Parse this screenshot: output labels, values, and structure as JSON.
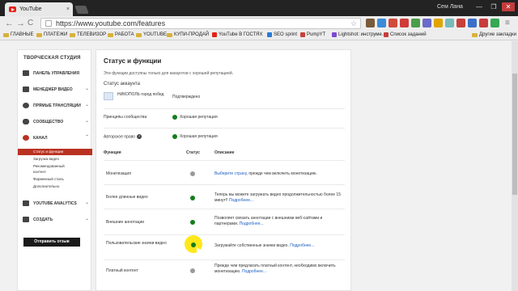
{
  "browser": {
    "tab_title": "YouTube",
    "tab_close": "×",
    "user_name": "Сем Лана",
    "window_buttons": {
      "minimize": "—",
      "maximize": "❐",
      "close": "✕"
    },
    "nav": {
      "back": "←",
      "forward": "→",
      "reload": "C"
    },
    "url": "https://www.youtube.com/features",
    "bookmark_star": "☆"
  },
  "bookmarks": {
    "items": [
      {
        "label": "ГЛАВНЫЕ",
        "icon": "folder-icon"
      },
      {
        "label": "ПЛАТЕЖИ",
        "icon": "folder-icon"
      },
      {
        "label": "ТЕЛЕВИЗОР",
        "icon": "folder-icon"
      },
      {
        "label": "РАБОТА",
        "icon": "folder-icon"
      },
      {
        "label": "YOUTUBE",
        "icon": "folder-icon"
      },
      {
        "label": "КУПИ-ПРОДАЙ",
        "icon": "folder-icon"
      },
      {
        "label": "YouTube В ГОСТЯХ",
        "icon": "youtube-icon"
      },
      {
        "label": "SEO sprint",
        "icon": "seo-icon"
      },
      {
        "label": "PumpYT",
        "icon": "pump-icon"
      },
      {
        "label": "Lightshot: инструме...",
        "icon": "lightshot-icon"
      },
      {
        "label": "Список заданий",
        "icon": "tasks-icon"
      }
    ],
    "other": "Другие закладки"
  },
  "sidebar": {
    "title": "ТВОРЧЕСКАЯ СТУДИЯ",
    "items": [
      {
        "label": "ПАНЕЛЬ УПРАВЛЕНИЯ",
        "icon": "dashboard-icon",
        "chevron": ""
      },
      {
        "label": "МЕНЕДЖЕР ВИДЕО",
        "icon": "video-manager-icon",
        "chevron": "⌄"
      },
      {
        "label": "ПРЯМЫЕ ТРАНСЛЯЦИИ",
        "icon": "live-icon",
        "chevron": "⌄"
      },
      {
        "label": "СООБЩЕСТВО",
        "icon": "community-icon",
        "chevron": "⌄"
      },
      {
        "label": "КАНАЛ",
        "icon": "channel-icon",
        "chevron": "⌃"
      }
    ],
    "channel_sub": [
      "Статус и функции",
      "Загрузка видео",
      "Рекомендованный",
      "контент",
      "Фирменный стиль",
      "Дополнительно"
    ],
    "analytics": {
      "label": "YOUTUBE ANALYTICS",
      "icon": "analytics-icon",
      "chevron": "⌄"
    },
    "create": {
      "label": "СОЗДАТЬ",
      "icon": "create-icon",
      "chevron": "⌄"
    },
    "feedback_button": "Отправить отзыв"
  },
  "main": {
    "title": "Статус и функции",
    "intro": "Эти функции доступны только для аккаунтов с хорошей репутацией.",
    "account_status_title": "Статус аккаунта",
    "account_name": "НИКОПОЛЬ город побед",
    "account_verified": "Подтверждено",
    "community": {
      "label": "Принципы сообщества",
      "status": "Хорошая репутация",
      "color": "#167d1c"
    },
    "copyright": {
      "label": "Авторское право",
      "help": "?",
      "status": "Хорошая репутация",
      "color": "#167d1c"
    },
    "table_headers": {
      "feature": "Функция",
      "status": "Статус",
      "description": "Описание"
    },
    "features": [
      {
        "name": "Монетизация",
        "status": "gray",
        "desc_link": "Выберите страну,",
        "desc": " прежде чем включить монетизацию."
      },
      {
        "name": "Более длинные видео",
        "status": "green",
        "desc": "Теперь вы можете загружать видео продолжительностью более 15 минут!!",
        "more": "Подробнее..."
      },
      {
        "name": "Внешние аннотации",
        "status": "green",
        "desc": "Позволяет связать аннотации с внешними веб-сайтами и партнерами.",
        "more": "Подробнее..."
      },
      {
        "name": "Пользовательские значки видео",
        "status": "green",
        "desc": "Загружайте собственные значки видео.",
        "more": "Подробнее..."
      },
      {
        "name": "Платный контент",
        "status": "gray",
        "desc": "Прежде чем предлагать платный контент, необходимо включить монетизацию.",
        "more": "Подробнее..."
      }
    ]
  }
}
